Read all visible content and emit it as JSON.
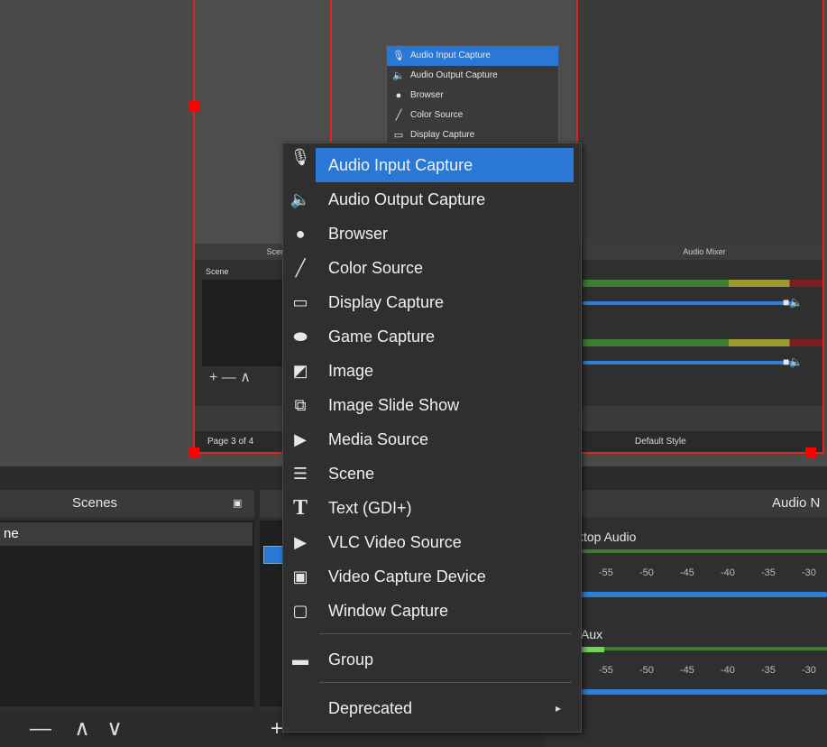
{
  "inner": {
    "mini_menu": [
      {
        "icon": "mic-icon",
        "label": "Audio Input Capture",
        "glyph": "🎙"
      },
      {
        "icon": "speaker-icon",
        "label": "Audio Output Capture",
        "glyph": "🔈"
      },
      {
        "icon": "globe-icon",
        "label": "Browser",
        "glyph": "●"
      },
      {
        "icon": "brush-icon",
        "label": "Color Source",
        "glyph": "╱"
      },
      {
        "icon": "monitor-icon",
        "label": "Display Capture",
        "glyph": "▭"
      }
    ],
    "scenes_header": "Scen",
    "scene_label": "Scene",
    "mixer_header": "Audio Mixer",
    "page_label": "Page 3 of 4",
    "style_label": "Default Style"
  },
  "scenes": {
    "title": "Scenes",
    "selected": "ne",
    "toolbar": [
      "—",
      "∧",
      "∨"
    ]
  },
  "mixer": {
    "title": "Audio N",
    "channel1": "ktop Audio",
    "channel2": "Aux",
    "ticks": [
      "-55",
      "-50",
      "-45",
      "-40",
      "-35",
      "-30"
    ]
  },
  "context_menu": {
    "items": [
      {
        "icon": "mic-icon",
        "glyph": "🎙",
        "label": "Audio Input Capture",
        "highlighted": true
      },
      {
        "icon": "speaker-icon",
        "glyph": "🔈",
        "label": "Audio Output Capture"
      },
      {
        "icon": "globe-icon",
        "glyph": "🌐",
        "label": "Browser"
      },
      {
        "icon": "brush-icon",
        "glyph": "🖌",
        "label": "Color Source"
      },
      {
        "icon": "monitor-icon",
        "glyph": "🖵",
        "label": "Display Capture"
      },
      {
        "icon": "gamepad-icon",
        "glyph": "🎮",
        "label": "Game Capture"
      },
      {
        "icon": "image-icon",
        "glyph": "🖼",
        "label": "Image"
      },
      {
        "icon": "slideshow-icon",
        "glyph": "⧉",
        "label": "Image Slide Show"
      },
      {
        "icon": "play-icon",
        "glyph": "▶",
        "label": "Media Source"
      },
      {
        "icon": "list-icon",
        "glyph": "☰",
        "label": "Scene"
      },
      {
        "icon": "text-icon",
        "glyph": "T",
        "label": "Text (GDI+)"
      },
      {
        "icon": "play-icon",
        "glyph": "▶",
        "label": "VLC Video Source"
      },
      {
        "icon": "camera-icon",
        "glyph": "📷",
        "label": "Video Capture Device"
      },
      {
        "icon": "window-icon",
        "glyph": "▢",
        "label": "Window Capture"
      }
    ],
    "group": {
      "icon": "folder-icon",
      "glyph": "📁",
      "label": "Group"
    },
    "deprecated": {
      "label": "Deprecated",
      "arrow": "▸"
    }
  }
}
